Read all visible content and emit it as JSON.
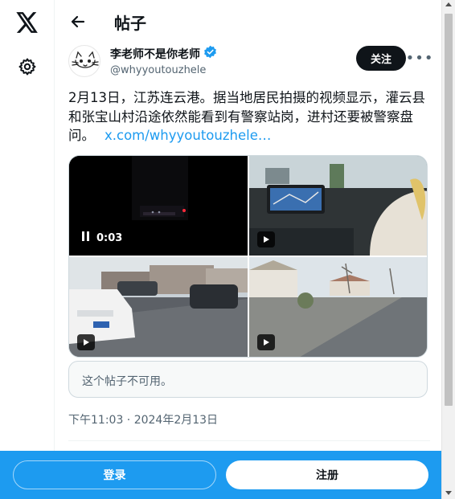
{
  "header": {
    "title": "帖子"
  },
  "author": {
    "display_name": "李老师不是你老师",
    "handle": "@whyyoutouzhele",
    "verified": true,
    "follow_label": "关注"
  },
  "tweet": {
    "text": "2月13日，江苏连云港。据当地居民拍摄的视频显示，灌云县和张宝山村沿途依然能看到有警察站岗，进村还要被警察盘问。",
    "link": "x.com/whyyoutouzhele…",
    "timestamp": "下午11:03 · 2024年2月13日"
  },
  "media": {
    "video_time": "0:03"
  },
  "quote": {
    "text": "这个帖子不可用。"
  },
  "bottom_bar": {
    "login_label": "登录",
    "signup_label": "注册"
  },
  "colors": {
    "accent": "#1d9bf0",
    "text": "#0f1419",
    "muted": "#536471"
  }
}
